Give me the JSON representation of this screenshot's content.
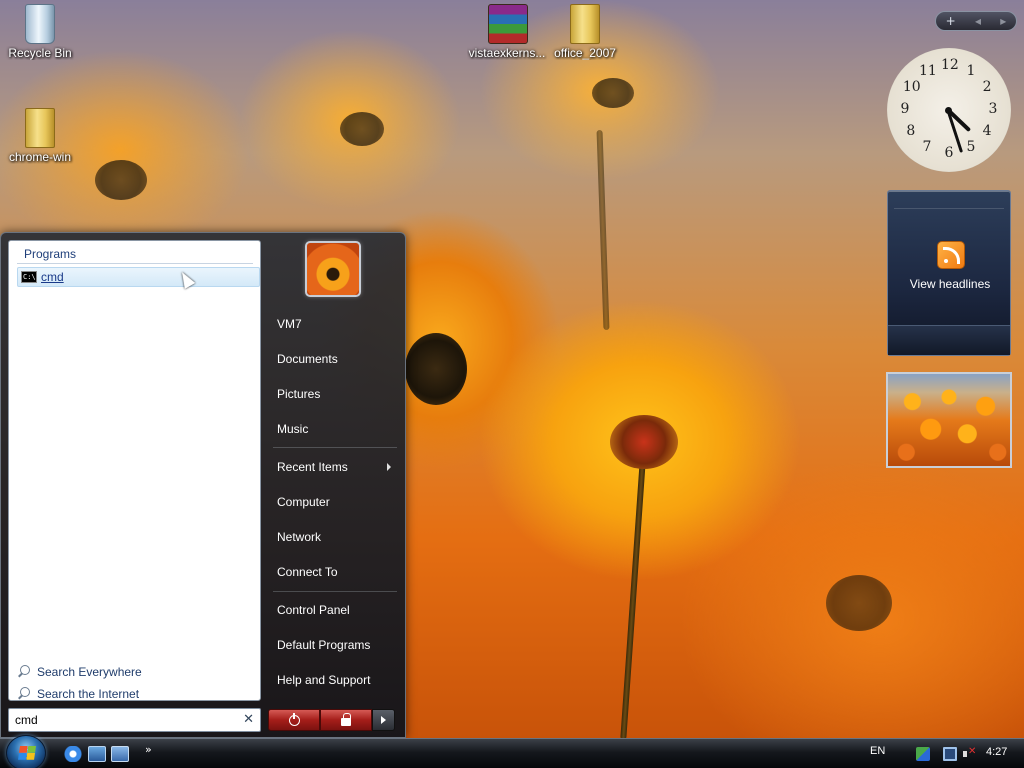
{
  "desktop": {
    "icons": [
      {
        "label": "Recycle Bin"
      },
      {
        "label": "chrome-win"
      },
      {
        "label": "vistaexkerns..."
      },
      {
        "label": "office_2007"
      }
    ]
  },
  "start_menu": {
    "programs_header": "Programs",
    "results": [
      {
        "label": "cmd",
        "icon": "cmd-icon"
      }
    ],
    "search_links": {
      "everywhere": "Search Everywhere",
      "internet": "Search the Internet"
    },
    "search": {
      "value": "cmd",
      "clear_icon": "close-icon"
    },
    "right_pane": {
      "items": [
        "VM7",
        "Documents",
        "Pictures",
        "Music",
        "Recent Items",
        "Computer",
        "Network",
        "Connect To",
        "Control Panel",
        "Default Programs",
        "Help and Support"
      ]
    },
    "power_bar": {
      "power_icon": "power-icon",
      "lock_icon": "lock-icon",
      "more_icon": "chevron-right-icon",
      "color": "#a51e1a"
    }
  },
  "sidebar": {
    "clock_numerals": [
      "12",
      "1",
      "2",
      "3",
      "4",
      "5",
      "6",
      "7",
      "8",
      "9",
      "10",
      "11"
    ],
    "clock_time": {
      "hour": 4,
      "minute": 27
    },
    "feed_gadget": {
      "label": "View headlines"
    }
  },
  "taskbar": {
    "quick_launch_more": "»",
    "language": "EN",
    "time": "4:27"
  }
}
